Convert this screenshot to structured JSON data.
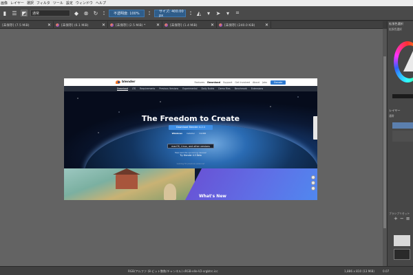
{
  "menubar": {
    "items": [
      "画像",
      "レイヤー",
      "選択",
      "フィルタ",
      "ツール",
      "設定",
      "ウィンドウ",
      "ヘルプ"
    ]
  },
  "toolbar": {
    "blend_mode": "通常",
    "opacity_label": "不透明度: 100%",
    "size_label": "サイズ: 400.00 px"
  },
  "tabs": [
    {
      "label": "[未保存] (7.5 MiB)"
    },
    {
      "label": "[未保存] (6.1 MiB)"
    },
    {
      "label": "[未保存] (2.5 MiB) *"
    },
    {
      "label": "[未保存] (1.4 MiB)"
    },
    {
      "label": "[未保存] (240.0 KiB)"
    }
  ],
  "website": {
    "logo": "blender",
    "nav_links": [
      "Features",
      "Download",
      "Support",
      "Get Involved",
      "About",
      "Jobs"
    ],
    "store_button": "Donate",
    "subnav": [
      "Download",
      "LTS",
      "Requirements",
      "Previous Versions",
      "Experimental",
      "Daily Builds",
      "Demo Files",
      "Benchmark",
      "Extensions"
    ],
    "hero_title": "The Freedom to Create",
    "download_button": "Download Blender 4.2.1",
    "meta_os": "Windows",
    "meta_installer": "Installer",
    "meta_size": "344MB",
    "os_select": "macOS, Linux, and other versions",
    "help_line": "Help test the upcoming release!",
    "help_link": "Try Blender 4.3 Beta",
    "older_line": "Looking for previous versions?",
    "whats_new": "What's New"
  },
  "dock": {
    "color_title": "拡張色選択",
    "color_subtitle": "拡張色選択",
    "layers_title": "レイヤー",
    "blend_label": "通常",
    "brush_title": "ブラシプリセット"
  },
  "status": {
    "color_info": "RGB/アルファ (8-ビット整数/チャンネル)  sRGB-elle-V2-srgbtrc.icc",
    "size_info": "1,886 x 810 (13 MiB)",
    "zoom": "0.07"
  }
}
